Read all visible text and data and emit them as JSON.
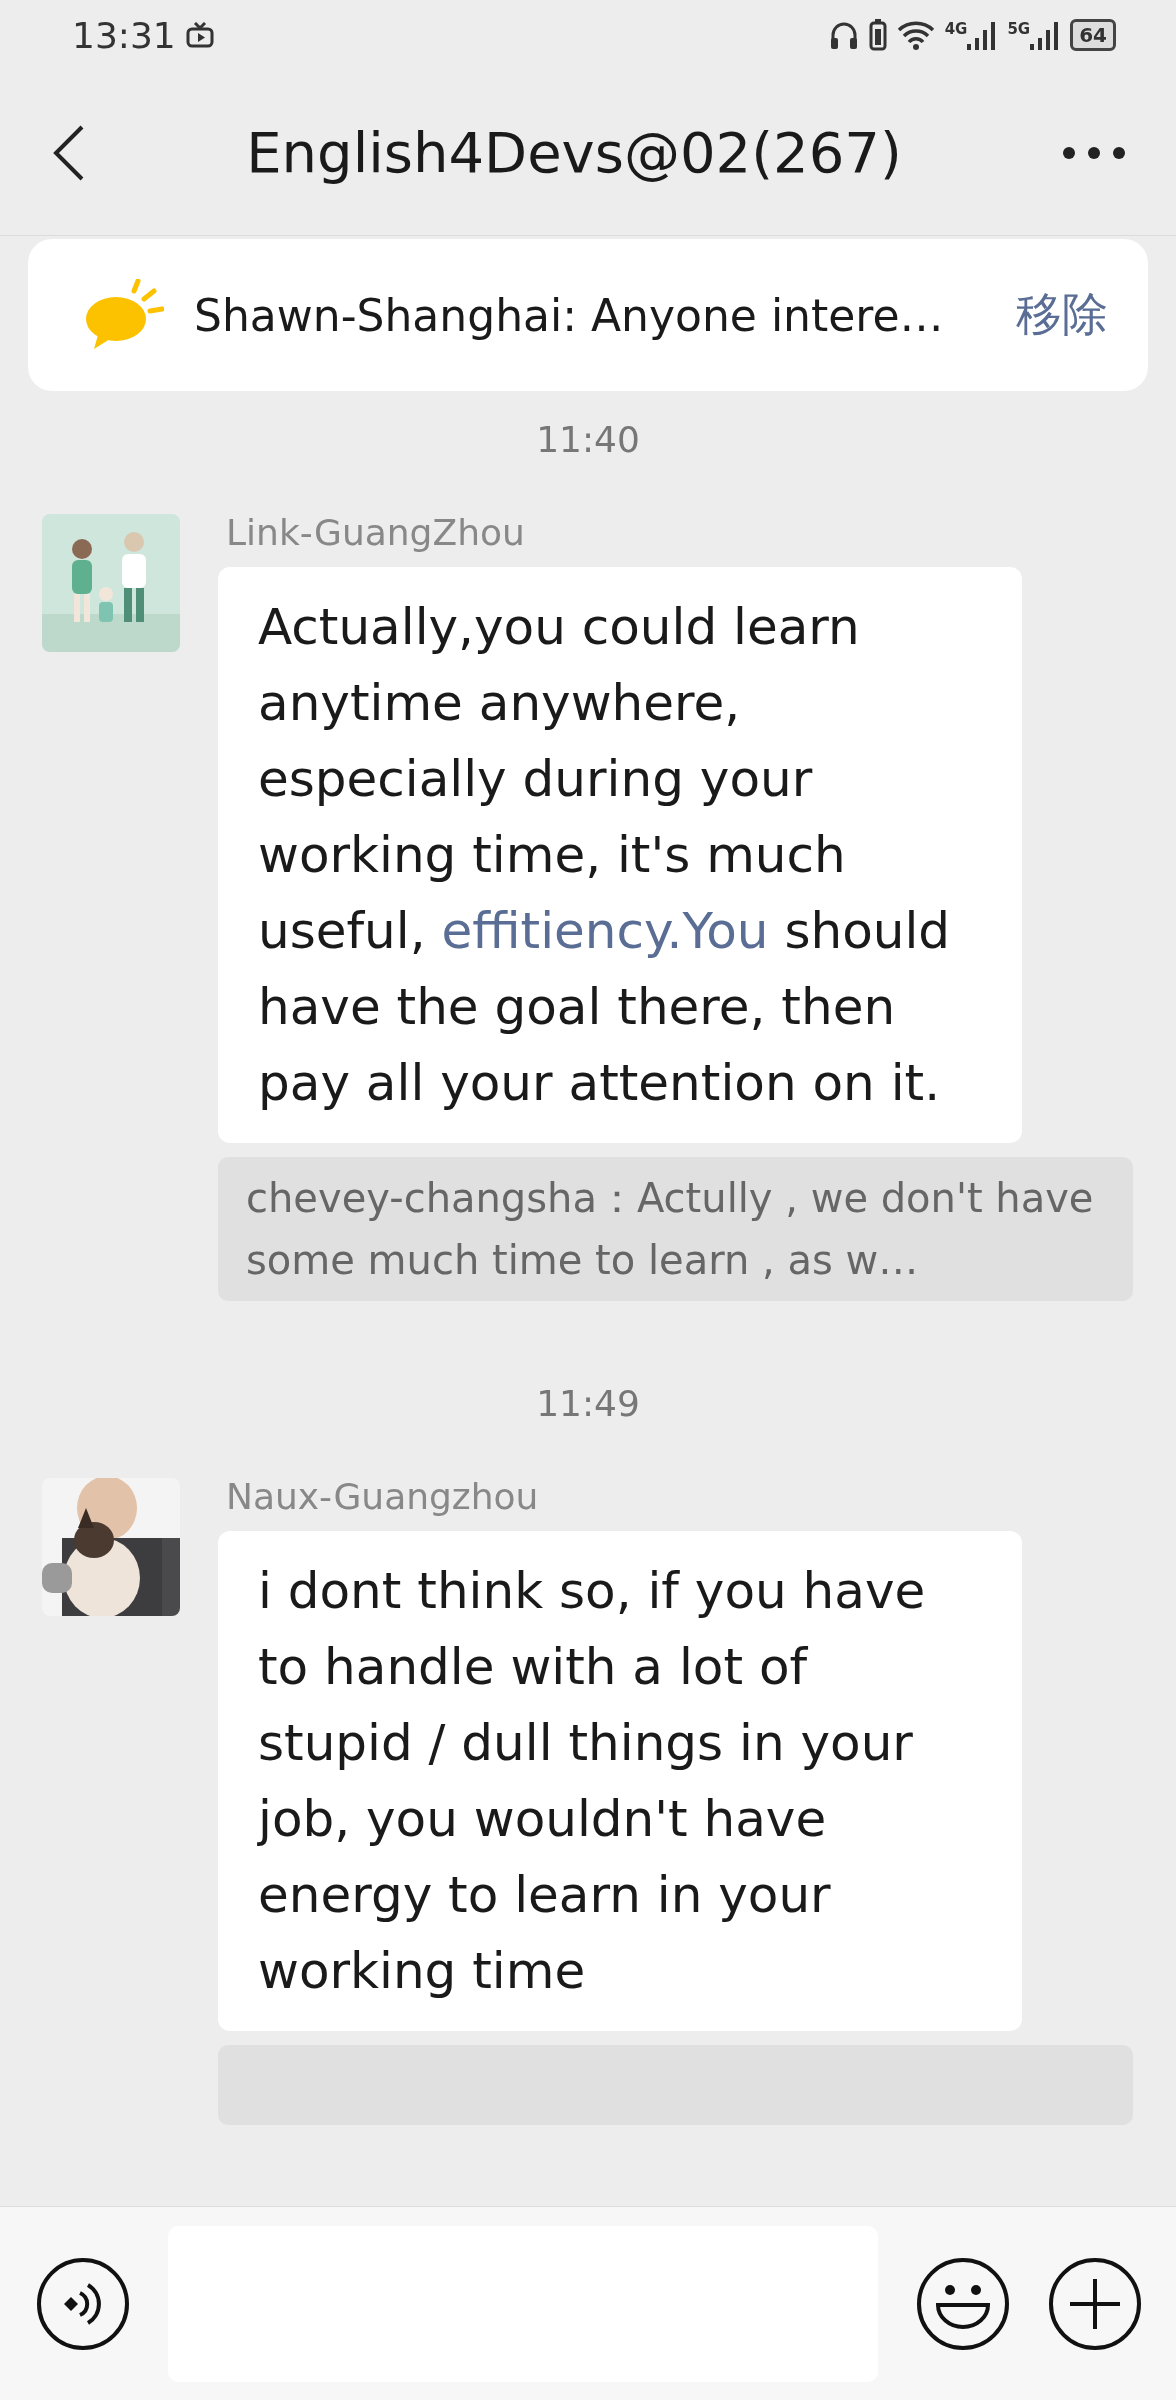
{
  "status_bar": {
    "time": "13:31",
    "network_1": "4G",
    "network_2": "5G",
    "battery": "64"
  },
  "header": {
    "title": "English4Devs@02(267)"
  },
  "pinned": {
    "text": "Shawn-Shanghai: Anyone intere…",
    "action": "移除"
  },
  "messages": [
    {
      "kind": "time",
      "text": "11:40"
    },
    {
      "kind": "message",
      "sender": "Link-GuangZhou",
      "parts": [
        {
          "kind": "text",
          "text": "Actually,you could learn anytime anywhere, especially during your working time, it's much useful, "
        },
        {
          "kind": "link",
          "text": "effitiency.You"
        },
        {
          "kind": "text",
          "text": " should have the goal there, then pay all your attention on it."
        }
      ]
    },
    {
      "kind": "quote",
      "text": "chevey-changsha：Actully , we don't have some much time to learn , as w…"
    },
    {
      "kind": "time",
      "text": "11:49"
    },
    {
      "kind": "message",
      "sender": "Naux-Guangzhou",
      "parts": [
        {
          "kind": "text",
          "text": "i dont think so, if you have to handle with a lot of stupid / dull things in your job, you wouldn't have energy to learn in your working time"
        }
      ]
    },
    {
      "kind": "quote_cut"
    }
  ]
}
